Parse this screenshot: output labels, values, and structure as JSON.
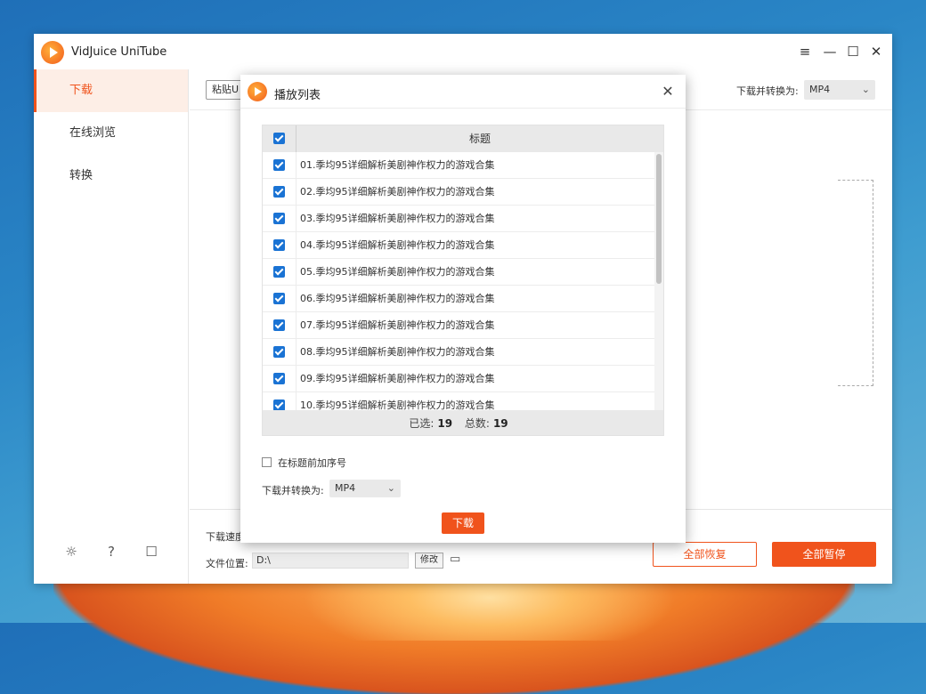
{
  "app": {
    "title": "VidJuice UniTube",
    "icons": {
      "menu": "menu-icon",
      "minimize": "minimize-icon",
      "maximize": "maximize-icon",
      "close": "close-icon"
    }
  },
  "sidebar": {
    "items": [
      {
        "label": "下载",
        "active": true
      },
      {
        "label": "在线浏览",
        "active": false
      },
      {
        "label": "转换",
        "active": false
      }
    ],
    "bottom_icons": [
      "bulb-icon",
      "help-icon",
      "chat-icon"
    ]
  },
  "toolbar": {
    "paste_label": "粘贴U",
    "convert_label": "下载并转换为:",
    "format": "MP4"
  },
  "bottom": {
    "speed_label": "下载速度",
    "location_label": "文件位置:",
    "location_value": "D:\\",
    "modify_label": "修改",
    "resume_all": "全部恢复",
    "pause_all": "全部暂停"
  },
  "dialog": {
    "title": "播放列表",
    "column_title": "标题",
    "items": [
      "01.季均95详细解析美剧神作权力的游戏合集",
      "02.季均95详细解析美剧神作权力的游戏合集",
      "03.季均95详细解析美剧神作权力的游戏合集",
      "04.季均95详细解析美剧神作权力的游戏合集",
      "05.季均95详细解析美剧神作权力的游戏合集",
      "06.季均95详细解析美剧神作权力的游戏合集",
      "07.季均95详细解析美剧神作权力的游戏合集",
      "08.季均95详细解析美剧神作权力的游戏合集",
      "09.季均95详细解析美剧神作权力的游戏合集",
      "10.季均95详细解析美剧神作权力的游戏合集"
    ],
    "selected_label": "已选:",
    "selected_count": "19",
    "total_label": "总数:",
    "total_count": "19",
    "sequence_label": "在标题前加序号",
    "convert_label": "下载并转换为:",
    "format": "MP4",
    "download_label": "下载"
  },
  "colors": {
    "accent": "#f0531c",
    "checkbox": "#1a73d4"
  }
}
